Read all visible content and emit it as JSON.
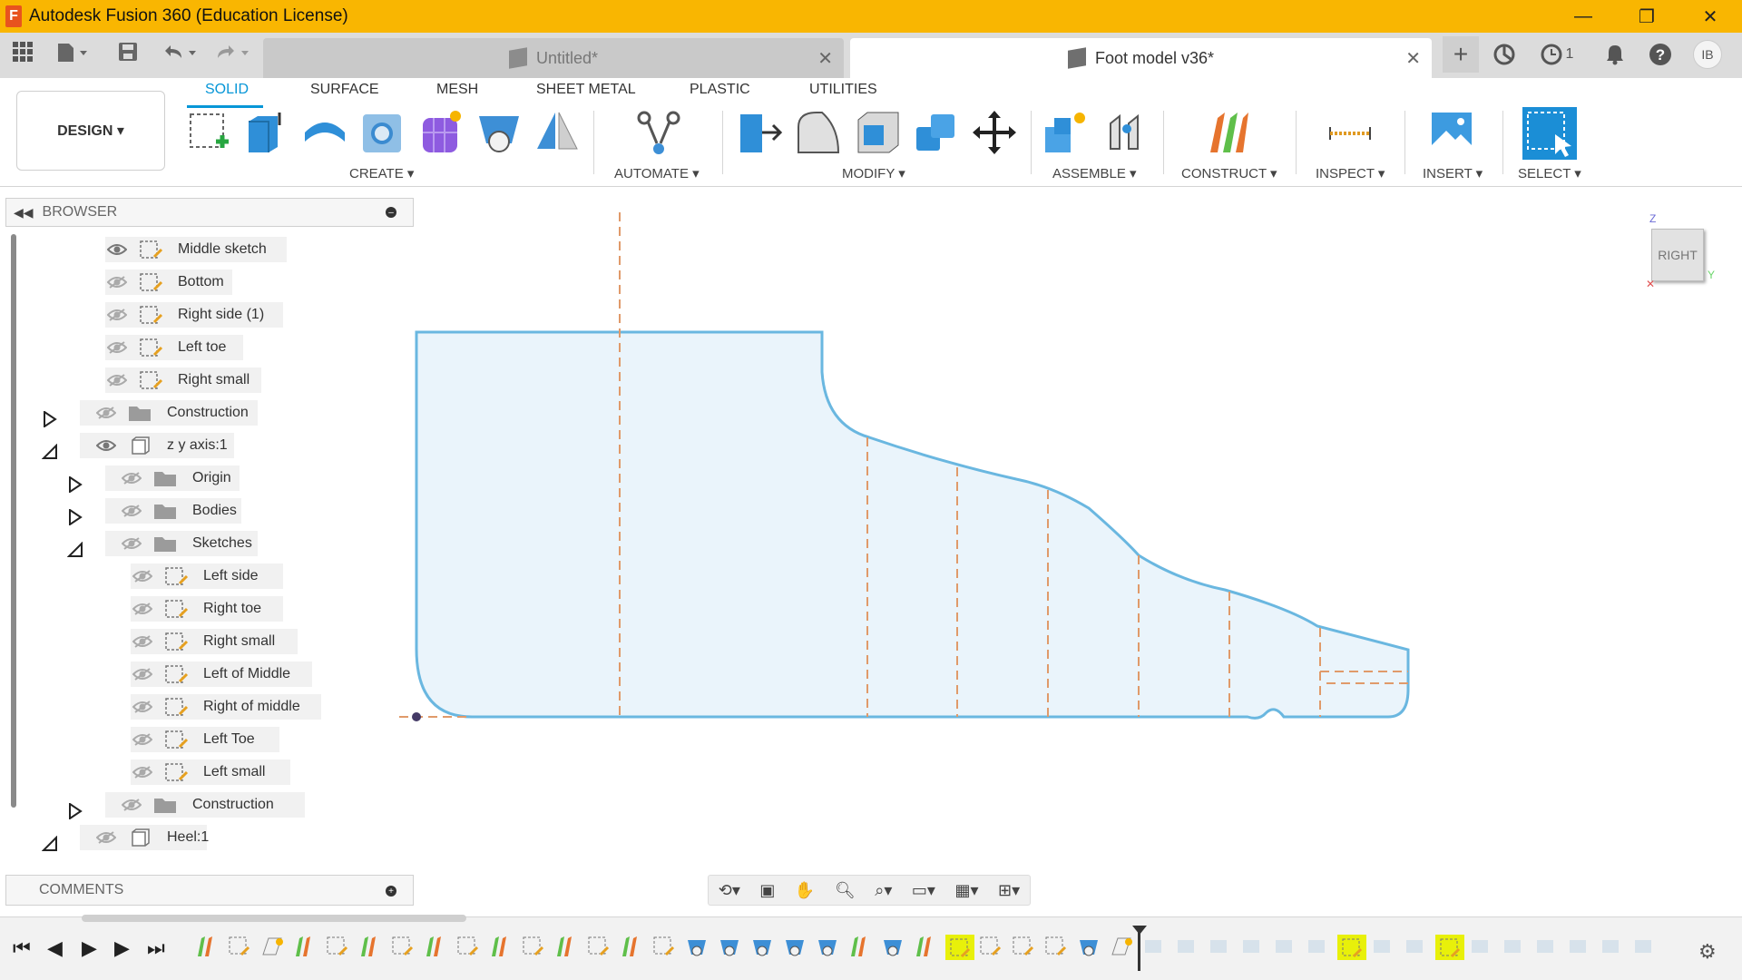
{
  "window": {
    "title": "Autodesk Fusion 360 (Education License)",
    "app_letter": "F",
    "minimize": "—",
    "maximize": "❐",
    "close": "✕"
  },
  "tabs": {
    "inactive_label": "Untitled*",
    "active_label": "Foot model v36*",
    "close_glyph": "✕",
    "jobs_count": "1",
    "user_initials": "IB"
  },
  "ribbon": {
    "workspace": "DESIGN ▾",
    "tabs": [
      "SOLID",
      "SURFACE",
      "MESH",
      "SHEET METAL",
      "PLASTIC",
      "UTILITIES"
    ],
    "groups": [
      "CREATE ▾",
      "AUTOMATE ▾",
      "MODIFY ▾",
      "ASSEMBLE ▾",
      "CONSTRUCT ▾",
      "INSPECT ▾",
      "INSERT ▾",
      "SELECT ▾"
    ]
  },
  "browser": {
    "title": "BROWSER",
    "items": [
      {
        "label": "Middle sketch",
        "type": "sketch",
        "visible": true
      },
      {
        "label": "Bottom",
        "type": "sketch",
        "visible": false
      },
      {
        "label": "Right side (1)",
        "type": "sketch",
        "visible": false
      },
      {
        "label": "Left toe",
        "type": "sketch",
        "visible": false
      },
      {
        "label": "Right small",
        "type": "sketch",
        "visible": false
      },
      {
        "label": "Construction",
        "type": "folder",
        "visible": false,
        "expander": "collapsed"
      },
      {
        "label": "z y axis:1",
        "type": "component",
        "visible": true,
        "expander": "expanded"
      },
      {
        "label": "Origin",
        "type": "folder",
        "visible": false,
        "expander": "collapsed"
      },
      {
        "label": "Bodies",
        "type": "folder",
        "visible": false,
        "expander": "collapsed"
      },
      {
        "label": "Sketches",
        "type": "folder",
        "visible": false,
        "expander": "expanded"
      },
      {
        "label": "Left side",
        "type": "sketch",
        "visible": false
      },
      {
        "label": "Right toe",
        "type": "sketch",
        "visible": false
      },
      {
        "label": "Right small",
        "type": "sketch",
        "visible": false
      },
      {
        "label": "Left of Middle",
        "type": "sketch",
        "visible": false
      },
      {
        "label": "Right of middle",
        "type": "sketch",
        "visible": false
      },
      {
        "label": "Left Toe",
        "type": "sketch",
        "visible": false
      },
      {
        "label": "Left small",
        "type": "sketch",
        "visible": false
      },
      {
        "label": "Construction",
        "type": "folder",
        "visible": false,
        "expander": "collapsed"
      },
      {
        "label": "Heel:1",
        "type": "component",
        "visible": false,
        "expander": "expanded"
      }
    ]
  },
  "comments": {
    "title": "COMMENTS"
  },
  "viewcube": {
    "face": "RIGHT",
    "axis_z": "Z",
    "axis_y": "Y"
  },
  "navbar": {
    "icons": [
      "orbit-icon",
      "look-at-icon",
      "pan-icon",
      "zoom-icon",
      "zoom-window-icon",
      "display-settings-icon",
      "grid-icon",
      "viewports-icon"
    ]
  },
  "timeline": {
    "controls": [
      "⏮",
      "◀",
      "▶",
      "▶",
      "⏭"
    ],
    "gear": "⚙"
  },
  "colors": {
    "title_bar": "#f9b601",
    "accent": "#0696d7",
    "profile_fill": "#eaf4fb",
    "profile_stroke": "#6ab7e0",
    "construction_line": "#e09a6a"
  }
}
